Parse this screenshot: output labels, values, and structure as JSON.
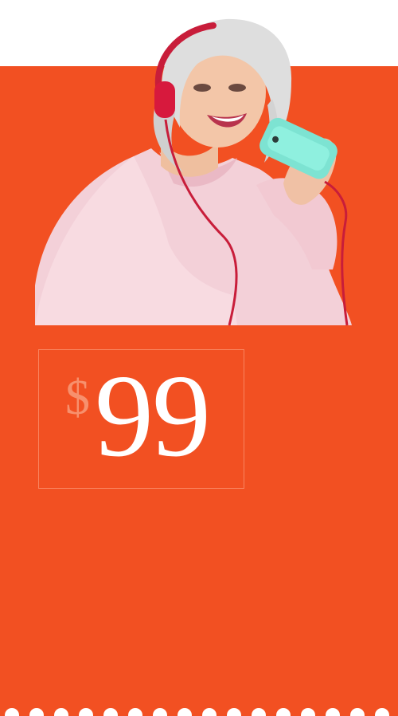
{
  "price": {
    "currency_symbol": "$",
    "amount": "99"
  },
  "image": {
    "subject": "woman-with-headphones-and-phone"
  },
  "colors": {
    "background": "#f25022",
    "top_band": "#ffffff",
    "price_text": "#ffffff",
    "currency_text": "#f7906d",
    "box_border": "#ffaf91"
  }
}
